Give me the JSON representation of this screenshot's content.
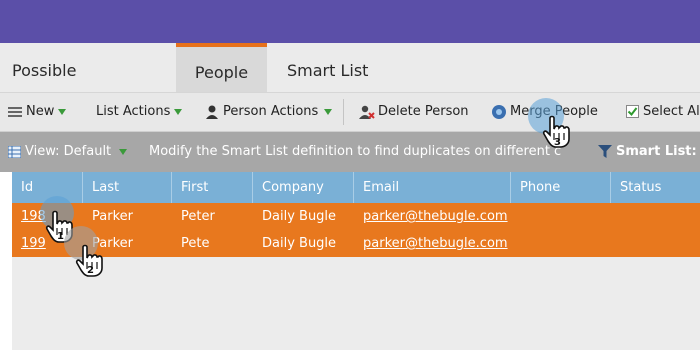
{
  "tabs": [
    {
      "label": "Possible Duplicates"
    },
    {
      "label": "People"
    },
    {
      "label": "Smart List"
    }
  ],
  "toolbar": {
    "new_label": "New",
    "list_actions_label": "List Actions",
    "person_actions_label": "Person Actions",
    "delete_person_label": "Delete Person",
    "merge_people_label": "Merge People",
    "select_all_label": "Select All"
  },
  "viewbar": {
    "view_label": "View: Default",
    "message": "Modify the Smart List definition to find duplicates on different criteria.",
    "smart_list_label": "Smart List: D"
  },
  "table": {
    "columns": [
      "Id",
      "Last",
      "First",
      "Company",
      "Email",
      "Phone",
      "Status"
    ],
    "rows": [
      {
        "id": "198",
        "last": "Parker",
        "first": "Peter",
        "company": "Daily Bugle",
        "email": "parker@thebugle.com",
        "phone": "",
        "status": ""
      },
      {
        "id": "199",
        "last": "Parker",
        "first": "Pete",
        "company": "Daily Bugle",
        "email": "parker@thebugle.com",
        "phone": "",
        "status": ""
      }
    ]
  },
  "annotations": {
    "step1": "1",
    "step2": "2",
    "step3": "3"
  },
  "colors": {
    "topbar": "#5b4fa8",
    "active_tab_accent": "#e7711b",
    "header_row": "#7ab0d6",
    "selected_row": "#e8781e"
  }
}
